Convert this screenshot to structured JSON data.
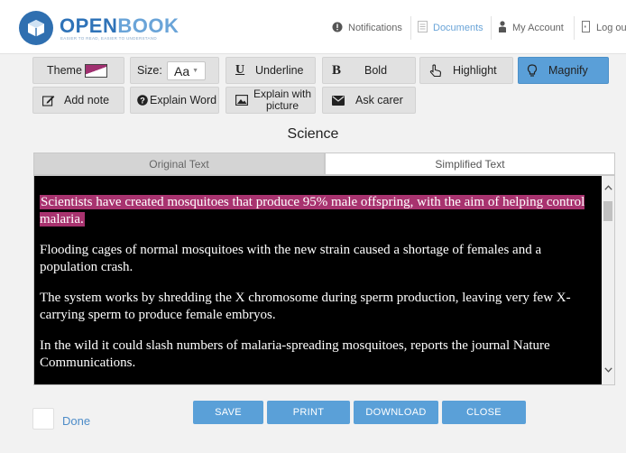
{
  "header": {
    "logo": {
      "name_main": "OPEN",
      "name_accent": "BOOK",
      "tagline": "EASIER TO READ, EASIER TO UNDERSTAND",
      "brand_color": "#2f73b8"
    },
    "nav": {
      "notifications": "Notifications",
      "documents": "Documents",
      "my_account": "My Account",
      "logout": "Log ou"
    }
  },
  "toolbar": {
    "theme": "Theme",
    "size": "Size:",
    "size_value": "Aa",
    "underline": "Underline",
    "underline_glyph": "U",
    "bold": "Bold",
    "bold_glyph": "B",
    "highlight": "Highlight",
    "magnify": "Magnify",
    "add_note": "Add note",
    "explain_word": "Explain Word",
    "explain_picture_line1": "Explain with",
    "explain_picture_line2": "picture",
    "ask_carer": "Ask carer",
    "active_color": "#5a9fd8"
  },
  "section_title": "Science",
  "tabs": {
    "original": "Original Text",
    "simplified": "Simplified Text"
  },
  "reader": {
    "highlight_color": "#a8336f",
    "paragraphs": [
      "Scientists have created mosquitoes that produce 95% male offspring, with the aim of helping control malaria.",
      "Flooding cages of normal mosquitoes with the new strain caused a shortage of females and a population crash.",
      "The system works by shredding the X chromosome during sperm production, leaving very few X-carrying sperm to produce female embryos.",
      "In the wild it could slash numbers of malaria-spreading mosquitoes, reports the journal Nature Communications."
    ]
  },
  "footer": {
    "done": "Done",
    "save": "SAVE",
    "print": "PRINT",
    "download": "DOWNLOAD",
    "close": "CLOSE"
  }
}
